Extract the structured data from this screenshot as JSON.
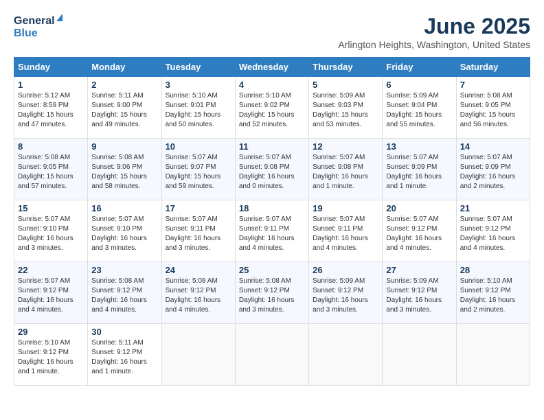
{
  "header": {
    "logo_line1": "General",
    "logo_line2": "Blue",
    "month_year": "June 2025",
    "location": "Arlington Heights, Washington, United States"
  },
  "calendar": {
    "headers": [
      "Sunday",
      "Monday",
      "Tuesday",
      "Wednesday",
      "Thursday",
      "Friday",
      "Saturday"
    ],
    "weeks": [
      [
        {
          "day": "1",
          "info": "Sunrise: 5:12 AM\nSunset: 8:59 PM\nDaylight: 15 hours\nand 47 minutes."
        },
        {
          "day": "2",
          "info": "Sunrise: 5:11 AM\nSunset: 9:00 PM\nDaylight: 15 hours\nand 49 minutes."
        },
        {
          "day": "3",
          "info": "Sunrise: 5:10 AM\nSunset: 9:01 PM\nDaylight: 15 hours\nand 50 minutes."
        },
        {
          "day": "4",
          "info": "Sunrise: 5:10 AM\nSunset: 9:02 PM\nDaylight: 15 hours\nand 52 minutes."
        },
        {
          "day": "5",
          "info": "Sunrise: 5:09 AM\nSunset: 9:03 PM\nDaylight: 15 hours\nand 53 minutes."
        },
        {
          "day": "6",
          "info": "Sunrise: 5:09 AM\nSunset: 9:04 PM\nDaylight: 15 hours\nand 55 minutes."
        },
        {
          "day": "7",
          "info": "Sunrise: 5:08 AM\nSunset: 9:05 PM\nDaylight: 15 hours\nand 56 minutes."
        }
      ],
      [
        {
          "day": "8",
          "info": "Sunrise: 5:08 AM\nSunset: 9:05 PM\nDaylight: 15 hours\nand 57 minutes."
        },
        {
          "day": "9",
          "info": "Sunrise: 5:08 AM\nSunset: 9:06 PM\nDaylight: 15 hours\nand 58 minutes."
        },
        {
          "day": "10",
          "info": "Sunrise: 5:07 AM\nSunset: 9:07 PM\nDaylight: 15 hours\nand 59 minutes."
        },
        {
          "day": "11",
          "info": "Sunrise: 5:07 AM\nSunset: 9:08 PM\nDaylight: 16 hours\nand 0 minutes."
        },
        {
          "day": "12",
          "info": "Sunrise: 5:07 AM\nSunset: 9:08 PM\nDaylight: 16 hours\nand 1 minute."
        },
        {
          "day": "13",
          "info": "Sunrise: 5:07 AM\nSunset: 9:09 PM\nDaylight: 16 hours\nand 1 minute."
        },
        {
          "day": "14",
          "info": "Sunrise: 5:07 AM\nSunset: 9:09 PM\nDaylight: 16 hours\nand 2 minutes."
        }
      ],
      [
        {
          "day": "15",
          "info": "Sunrise: 5:07 AM\nSunset: 9:10 PM\nDaylight: 16 hours\nand 3 minutes."
        },
        {
          "day": "16",
          "info": "Sunrise: 5:07 AM\nSunset: 9:10 PM\nDaylight: 16 hours\nand 3 minutes."
        },
        {
          "day": "17",
          "info": "Sunrise: 5:07 AM\nSunset: 9:11 PM\nDaylight: 16 hours\nand 3 minutes."
        },
        {
          "day": "18",
          "info": "Sunrise: 5:07 AM\nSunset: 9:11 PM\nDaylight: 16 hours\nand 4 minutes."
        },
        {
          "day": "19",
          "info": "Sunrise: 5:07 AM\nSunset: 9:11 PM\nDaylight: 16 hours\nand 4 minutes."
        },
        {
          "day": "20",
          "info": "Sunrise: 5:07 AM\nSunset: 9:12 PM\nDaylight: 16 hours\nand 4 minutes."
        },
        {
          "day": "21",
          "info": "Sunrise: 5:07 AM\nSunset: 9:12 PM\nDaylight: 16 hours\nand 4 minutes."
        }
      ],
      [
        {
          "day": "22",
          "info": "Sunrise: 5:07 AM\nSunset: 9:12 PM\nDaylight: 16 hours\nand 4 minutes."
        },
        {
          "day": "23",
          "info": "Sunrise: 5:08 AM\nSunset: 9:12 PM\nDaylight: 16 hours\nand 4 minutes."
        },
        {
          "day": "24",
          "info": "Sunrise: 5:08 AM\nSunset: 9:12 PM\nDaylight: 16 hours\nand 4 minutes."
        },
        {
          "day": "25",
          "info": "Sunrise: 5:08 AM\nSunset: 9:12 PM\nDaylight: 16 hours\nand 3 minutes."
        },
        {
          "day": "26",
          "info": "Sunrise: 5:09 AM\nSunset: 9:12 PM\nDaylight: 16 hours\nand 3 minutes."
        },
        {
          "day": "27",
          "info": "Sunrise: 5:09 AM\nSunset: 9:12 PM\nDaylight: 16 hours\nand 3 minutes."
        },
        {
          "day": "28",
          "info": "Sunrise: 5:10 AM\nSunset: 9:12 PM\nDaylight: 16 hours\nand 2 minutes."
        }
      ],
      [
        {
          "day": "29",
          "info": "Sunrise: 5:10 AM\nSunset: 9:12 PM\nDaylight: 16 hours\nand 1 minute."
        },
        {
          "day": "30",
          "info": "Sunrise: 5:11 AM\nSunset: 9:12 PM\nDaylight: 16 hours\nand 1 minute."
        },
        {
          "day": "",
          "info": ""
        },
        {
          "day": "",
          "info": ""
        },
        {
          "day": "",
          "info": ""
        },
        {
          "day": "",
          "info": ""
        },
        {
          "day": "",
          "info": ""
        }
      ]
    ]
  }
}
